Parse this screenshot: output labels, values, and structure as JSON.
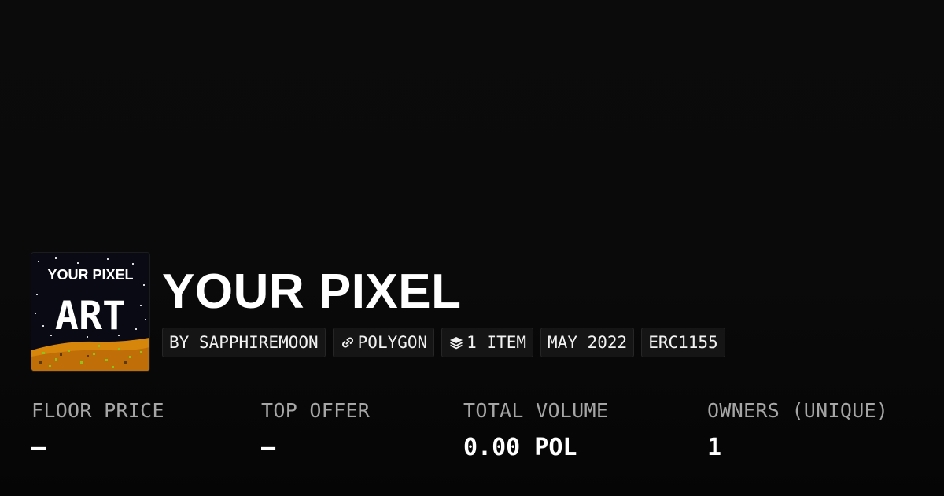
{
  "collection": {
    "title": "YOUR PIXEL",
    "thumbnail": {
      "line1": "YOUR PIXEL",
      "line2": "ART"
    }
  },
  "tags": [
    {
      "label": "BY SAPPHIREMOON",
      "icon": null
    },
    {
      "label": "POLYGON",
      "icon": "chain-link-icon"
    },
    {
      "label": "1 ITEM",
      "icon": "layers-stack-icon"
    },
    {
      "label": "MAY 2022",
      "icon": null
    },
    {
      "label": "ERC1155",
      "icon": null
    }
  ],
  "stats": {
    "floor_price": {
      "label": "FLOOR PRICE",
      "value": "–"
    },
    "top_offer": {
      "label": "TOP OFFER",
      "value": "–"
    },
    "total_volume": {
      "label": "TOTAL VOLUME",
      "value": "0.00 POL"
    },
    "owners": {
      "label": "OWNERS (UNIQUE)",
      "value": "1"
    }
  },
  "colors": {
    "background": "#0a0a0a",
    "tag_background": "#151515",
    "label_gray": "#a6a6a6",
    "text": "#ffffff"
  }
}
